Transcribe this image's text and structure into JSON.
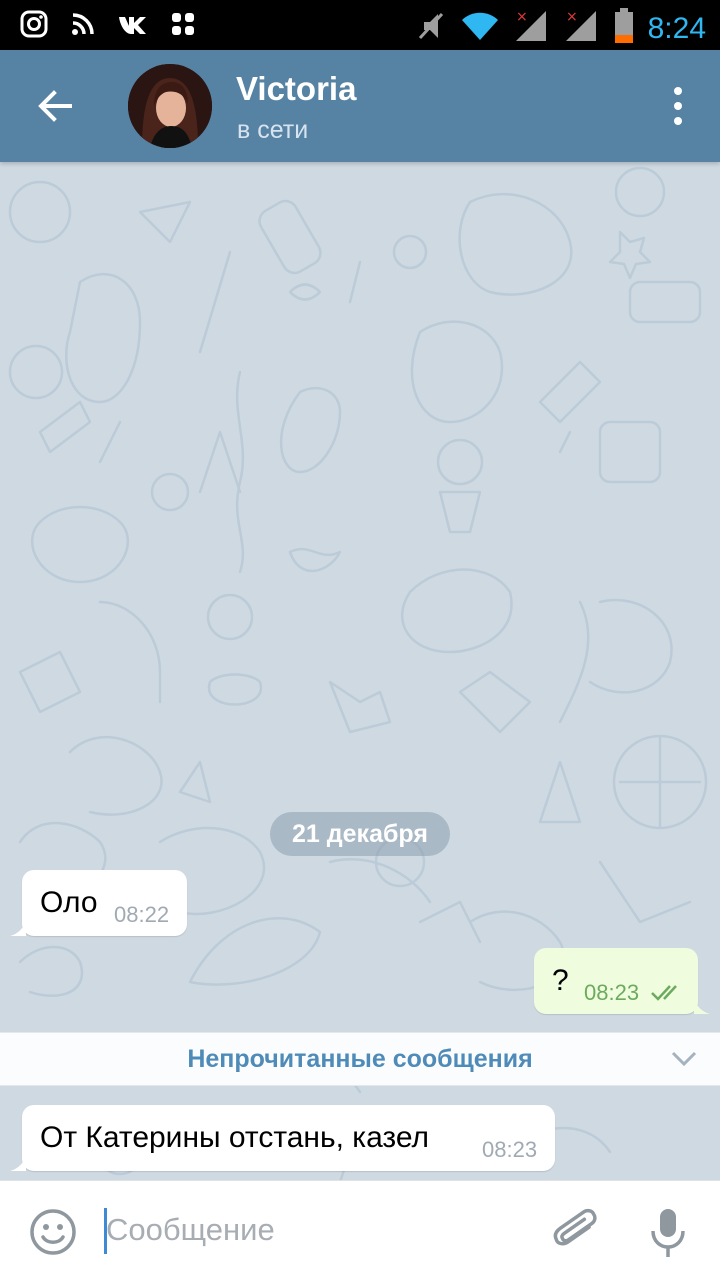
{
  "status_bar": {
    "time": "8:24",
    "icons": [
      "instagram-icon",
      "rss-icon",
      "vk-icon",
      "apps-icon",
      "mute-icon",
      "wifi-icon",
      "signal-icon",
      "signal-icon",
      "battery-icon"
    ],
    "accent_color": "#2fb7f2"
  },
  "header": {
    "contact_name": "Victoria",
    "contact_status": "в сети",
    "background_color": "#5682a3"
  },
  "chat": {
    "date_separator": "21 декабря",
    "messages": [
      {
        "direction": "incoming",
        "text": "Оло",
        "time": "08:22"
      },
      {
        "direction": "outgoing",
        "text": "?",
        "time": "08:23",
        "status": "read"
      },
      {
        "direction": "incoming",
        "text": "От Катерины отстань, казел",
        "time": "08:23"
      }
    ],
    "unread_label": "Непрочитанные сообщения"
  },
  "composer": {
    "placeholder": "Сообщение",
    "value": ""
  }
}
